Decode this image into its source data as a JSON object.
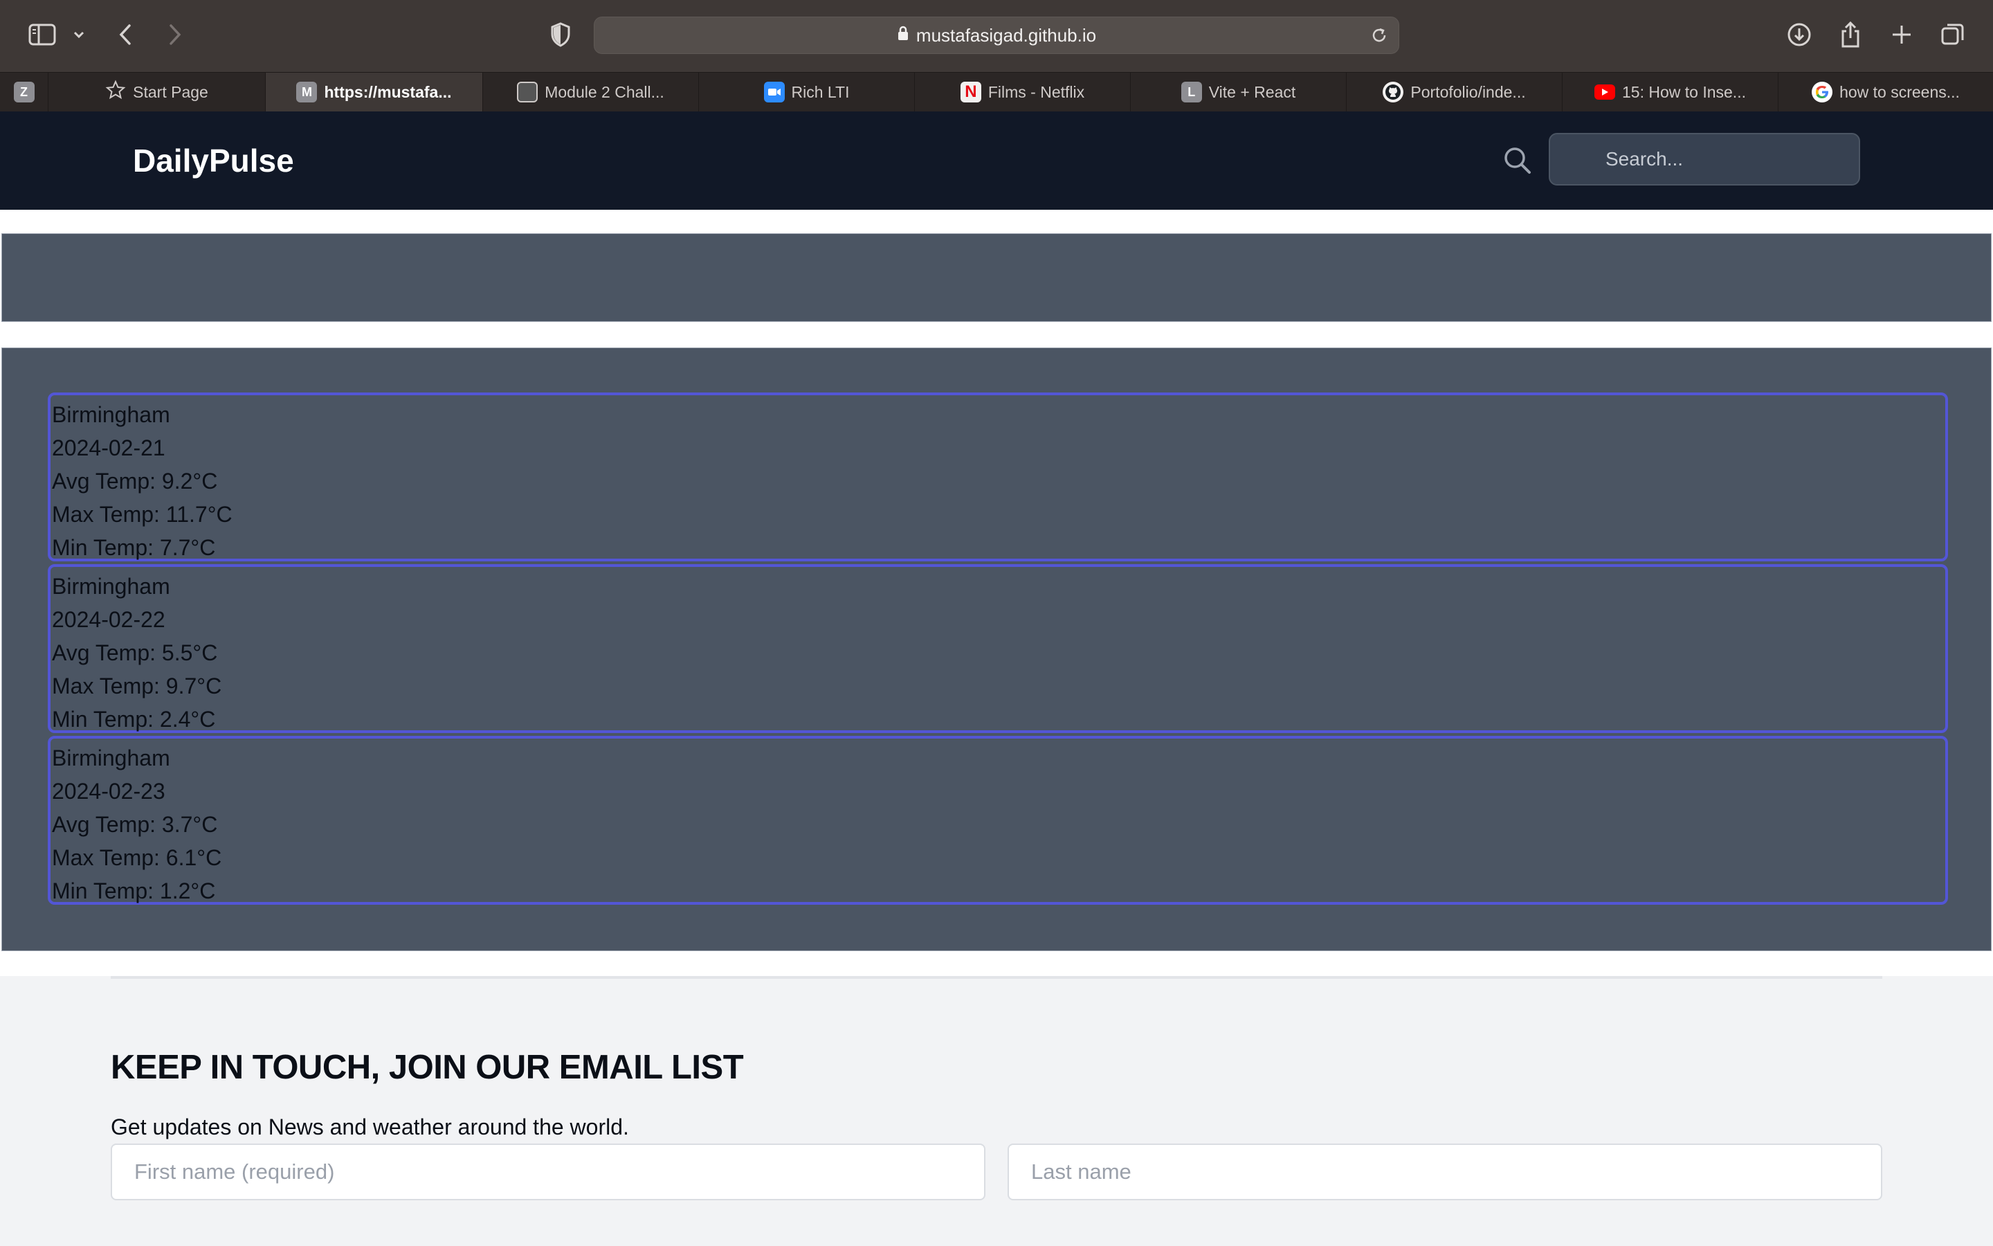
{
  "browser": {
    "url": "mustafasigad.github.io",
    "tabs": [
      {
        "label": "",
        "favicon": "Z",
        "favicon_color": "#8e8e93"
      },
      {
        "label": "Start Page",
        "favicon": "star-icon"
      },
      {
        "label": "https://mustafa...",
        "favicon": "M",
        "favicon_color": "#8e8e93",
        "active": true
      },
      {
        "label": "Module 2 Chall...",
        "favicon": "page-icon"
      },
      {
        "label": "Rich LTI",
        "favicon": "zoom-icon",
        "favicon_color": "#2d8cff"
      },
      {
        "label": "Films - Netflix",
        "favicon": "N",
        "favicon_color": "#e50914"
      },
      {
        "label": "Vite + React",
        "favicon": "L",
        "favicon_color": "#8e8e93"
      },
      {
        "label": "Portofolio/inde...",
        "favicon": "github-icon"
      },
      {
        "label": "15: How to Inse...",
        "favicon": "youtube-icon",
        "favicon_color": "#ff0000"
      },
      {
        "label": "how to screens...",
        "favicon": "google-icon"
      }
    ]
  },
  "site": {
    "brand": "DailyPulse",
    "search_placeholder": "Search..."
  },
  "forecast": [
    {
      "city": "Birmingham",
      "date": "2024-02-21",
      "avg": "Avg Temp: 9.2°C",
      "max": "Max Temp: 11.7°C",
      "min": "Min Temp: 7.7°C"
    },
    {
      "city": "Birmingham",
      "date": "2024-02-22",
      "avg": "Avg Temp: 5.5°C",
      "max": "Max Temp: 9.7°C",
      "min": "Min Temp: 2.4°C"
    },
    {
      "city": "Birmingham",
      "date": "2024-02-23",
      "avg": "Avg Temp: 3.7°C",
      "max": "Max Temp: 6.1°C",
      "min": "Min Temp: 1.2°C"
    }
  ],
  "newsletter": {
    "title": "KEEP IN TOUCH, JOIN OUR EMAIL LIST",
    "subtitle": "Get updates on News and weather around the world.",
    "first_name_placeholder": "First name (required)",
    "last_name_placeholder": "Last name"
  },
  "colors": {
    "header_bg": "#111827",
    "panel_bg": "#4b5563",
    "card_border": "#5356d6"
  }
}
